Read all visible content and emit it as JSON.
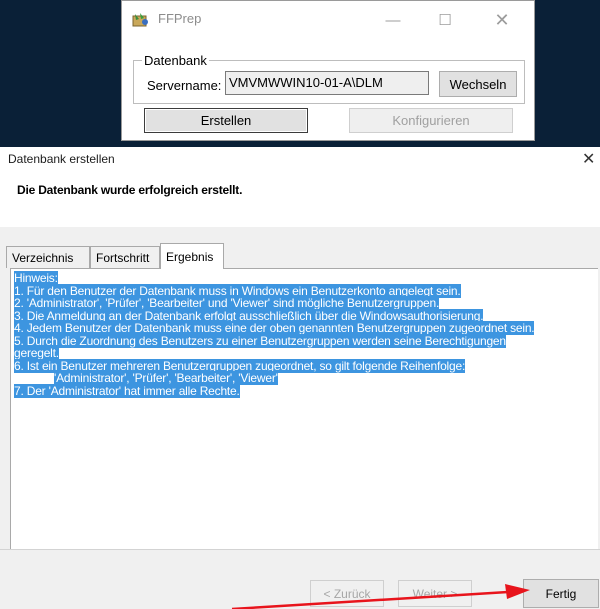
{
  "ffprep_window": {
    "title": "FFPrep",
    "group_label": "Datenbank",
    "servername_label": "Servername:",
    "servername_value": "VMVMWWIN10-01-A\\DLM",
    "wechseln_label": "Wechseln",
    "erstellen_label": "Erstellen",
    "konfigurieren_label": "Konfigurieren",
    "controls": {
      "minimize": "—",
      "maximize": "☐",
      "close": "✕"
    }
  },
  "dialog": {
    "title": "Datenbank erstellen",
    "close": "✕",
    "heading": "Die Datenbank wurde erfolgreich erstellt.",
    "tabs": [
      {
        "label": "Verzeichnis",
        "active": false
      },
      {
        "label": "Fortschritt",
        "active": false
      },
      {
        "label": "Ergebnis",
        "active": true
      }
    ],
    "result_lines": [
      "Hinweis:",
      "1. Für den Benutzer der Datenbank muss in Windows ein Benutzerkonto angelegt sein.",
      "2. 'Administrator', 'Prüfer', 'Bearbeiter' und 'Viewer' sind mögliche Benutzergruppen.",
      "3. Die Anmeldung an der Datenbank erfolgt ausschließlich über die Windowsauthorisierung.",
      "4. Jedem Benutzer der Datenbank muss eine der oben genannten Benutzergruppen zugeordnet sein.",
      "5. Durch die Zuordnung des Benutzers zu einer Benutzergruppen werden seine Berechtigungen",
      "geregelt.",
      "6. Ist ein Benutzer mehreren Benutzergruppen zugeordnet, so gilt folgende Reihenfolge:",
      "'Administrator', 'Prüfer', 'Bearbeiter', 'Viewer'",
      "7. Der 'Administrator' hat immer alle Rechte."
    ],
    "buttons": {
      "back": "< Zurück",
      "next": "Weiter >",
      "finish": "Fertig"
    }
  },
  "colors": {
    "selection": "#3d95e0",
    "annotation_arrow": "#e8141c",
    "desktop": "#0a2037"
  }
}
